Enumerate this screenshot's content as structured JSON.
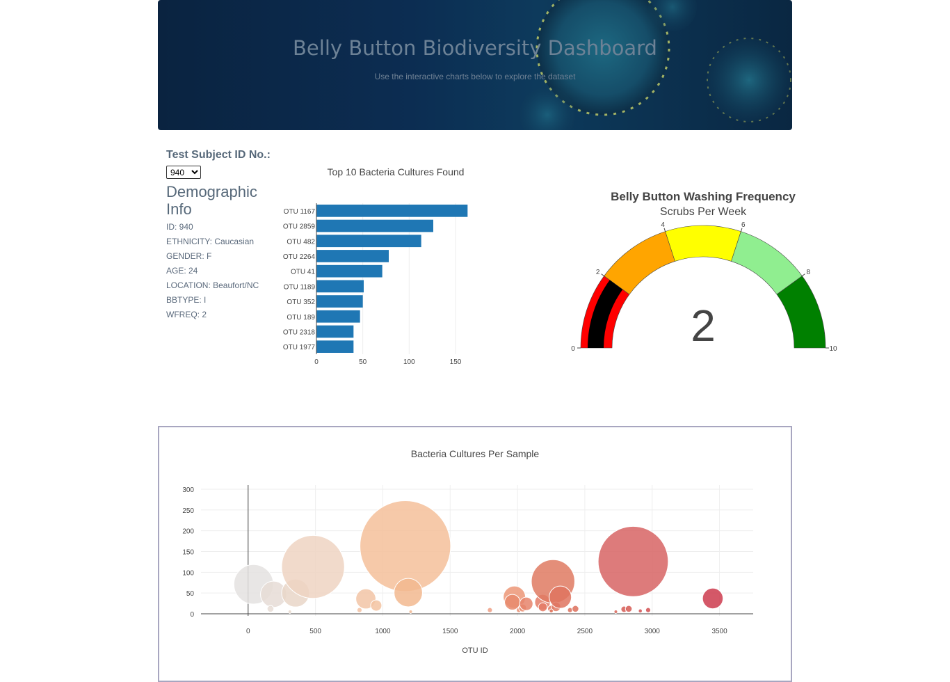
{
  "header": {
    "title": "Belly Button Biodiversity Dashboard",
    "subtitle": "Use the interactive charts below to explore the dataset"
  },
  "sidebar": {
    "select_label": "Test Subject ID No.:",
    "selected_id": "940",
    "demographic_title": "Demographic Info",
    "info": [
      "ID: 940",
      "ETHNICITY: Caucasian",
      "GENDER: F",
      "AGE: 24",
      "LOCATION: Beaufort/NC",
      "BBTYPE: I",
      "WFREQ: 2"
    ]
  },
  "colors": {
    "bar": "#1f77b4",
    "gauge_steps": [
      "#ff0000",
      "#ffa500",
      "#ffff00",
      "#90ee90",
      "#008000"
    ],
    "gauge_bar": "#000000"
  },
  "chart_data": [
    {
      "type": "bar",
      "orientation": "horizontal",
      "title": "Top 10 Bacteria Cultures Found",
      "categories": [
        "OTU 1167",
        "OTU 2859",
        "OTU 482",
        "OTU 2264",
        "OTU 41",
        "OTU 1189",
        "OTU 352",
        "OTU 189",
        "OTU 2318",
        "OTU 1977"
      ],
      "values": [
        163,
        126,
        113,
        78,
        71,
        51,
        50,
        47,
        40,
        40
      ],
      "xlim": [
        0,
        165
      ],
      "xticks": [
        0,
        50,
        100,
        150
      ]
    },
    {
      "type": "gauge",
      "title": "Belly Button Washing Frequency",
      "subtitle": "Scrubs Per Week",
      "value": 2,
      "range": [
        0,
        10
      ],
      "ticks": [
        0,
        2,
        4,
        6,
        8,
        10
      ],
      "steps": [
        [
          0,
          2
        ],
        [
          2,
          4
        ],
        [
          4,
          6
        ],
        [
          6,
          8
        ],
        [
          8,
          10
        ]
      ]
    },
    {
      "type": "scatter",
      "title": "Bacteria Cultures Per Sample",
      "xlabel": "OTU ID",
      "xlim": [
        -350,
        3750
      ],
      "ylim": [
        -5,
        310
      ],
      "xticks": [
        0,
        500,
        1000,
        1500,
        2000,
        2500,
        3000,
        3500
      ],
      "yticks": [
        0,
        50,
        100,
        150,
        200,
        250,
        300
      ],
      "points": [
        {
          "x": 41,
          "y": 71,
          "color": "#e4e2e0"
        },
        {
          "x": 189,
          "y": 47,
          "color": "#e6dcd6"
        },
        {
          "x": 352,
          "y": 50,
          "color": "#e9d6c8"
        },
        {
          "x": 482,
          "y": 113,
          "color": "#efd4c2"
        },
        {
          "x": 166,
          "y": 12,
          "color": "#e7ddd6"
        },
        {
          "x": 310,
          "y": 5,
          "color": "#e8d8cd"
        },
        {
          "x": 874,
          "y": 36,
          "color": "#f2c4a6"
        },
        {
          "x": 951,
          "y": 20,
          "color": "#f3c3a1"
        },
        {
          "x": 827,
          "y": 9,
          "color": "#f3c2a3"
        },
        {
          "x": 1167,
          "y": 163,
          "color": "#f5c09a"
        },
        {
          "x": 1189,
          "y": 51,
          "color": "#f2b88f"
        },
        {
          "x": 1207,
          "y": 5,
          "color": "#f0b690"
        },
        {
          "x": 1795,
          "y": 9,
          "color": "#ef9f84"
        },
        {
          "x": 1977,
          "y": 40,
          "color": "#ec9677"
        },
        {
          "x": 1962,
          "y": 28,
          "color": "#e8896c"
        },
        {
          "x": 2011,
          "y": 9,
          "color": "#ea8c6f"
        },
        {
          "x": 2038,
          "y": 14,
          "color": "#e8896c"
        },
        {
          "x": 2065,
          "y": 24,
          "color": "#e6846b"
        },
        {
          "x": 2186,
          "y": 28,
          "color": "#e47d67"
        },
        {
          "x": 2188,
          "y": 16,
          "color": "#e47b66"
        },
        {
          "x": 2249,
          "y": 12,
          "color": "#e2775f"
        },
        {
          "x": 2264,
          "y": 78,
          "color": "#df7a62"
        },
        {
          "x": 2285,
          "y": 17,
          "color": "#e07d66"
        },
        {
          "x": 2318,
          "y": 40,
          "color": "#df745f"
        },
        {
          "x": 2251,
          "y": 7,
          "color": "#e07a62"
        },
        {
          "x": 2390,
          "y": 9,
          "color": "#dd705c"
        },
        {
          "x": 2430,
          "y": 12,
          "color": "#dc6e5a"
        },
        {
          "x": 2730,
          "y": 5,
          "color": "#d86155"
        },
        {
          "x": 2791,
          "y": 11,
          "color": "#d65a53"
        },
        {
          "x": 2826,
          "y": 12,
          "color": "#d65a53"
        },
        {
          "x": 2859,
          "y": 126,
          "color": "#d76464"
        },
        {
          "x": 2912,
          "y": 7,
          "color": "#d45152"
        },
        {
          "x": 2970,
          "y": 9,
          "color": "#d24f50"
        },
        {
          "x": 3450,
          "y": 37,
          "color": "#cc3b4d"
        }
      ]
    }
  ]
}
